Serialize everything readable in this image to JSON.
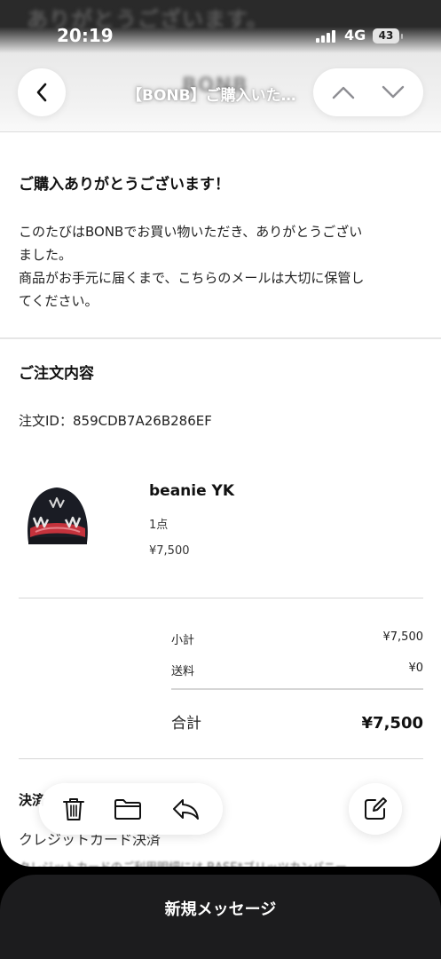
{
  "background": {
    "ghost_title": "ありがとうございます。",
    "ghost_logo": "BONB"
  },
  "status_bar": {
    "time": "20:19",
    "network": "4G",
    "battery": "43"
  },
  "nav": {
    "title": "【BONB】ご購入いた…",
    "back_icon": "chevron-left-icon",
    "up_icon": "chevron-up-icon",
    "down_icon": "chevron-down-icon"
  },
  "mail": {
    "thanks_heading": "ご購入ありがとうございます！",
    "intro_line1": "このたびはBONBでお買い物いただき、ありがとうござい",
    "intro_line2": "ました。",
    "intro_line3": "商品がお手元に届くまで、こちらのメールは大切に保管し",
    "intro_line4": "てください。",
    "order_heading": "ご注文内容",
    "order_id_label": "注文ID：",
    "order_id": "859CDB7A26B286EF",
    "item": {
      "name": "beanie YK",
      "qty": "1点",
      "price": "¥7,500"
    },
    "summary": {
      "subtotal_label": "小計",
      "subtotal": "¥7,500",
      "shipping_label": "送料",
      "shipping": "¥0",
      "total_label": "合計",
      "total": "¥7,500"
    },
    "payment_heading": "決済",
    "payment_method": "クレジットカード決済",
    "payment_note": "クレジットカードのご利用明細には BASE*ブリッツカンパニー"
  },
  "toolbar": {
    "trash_icon": "trash-icon",
    "folder_icon": "folder-icon",
    "reply_icon": "reply-icon",
    "compose_icon": "compose-icon"
  },
  "new_message": {
    "label": "新規メッセージ"
  }
}
